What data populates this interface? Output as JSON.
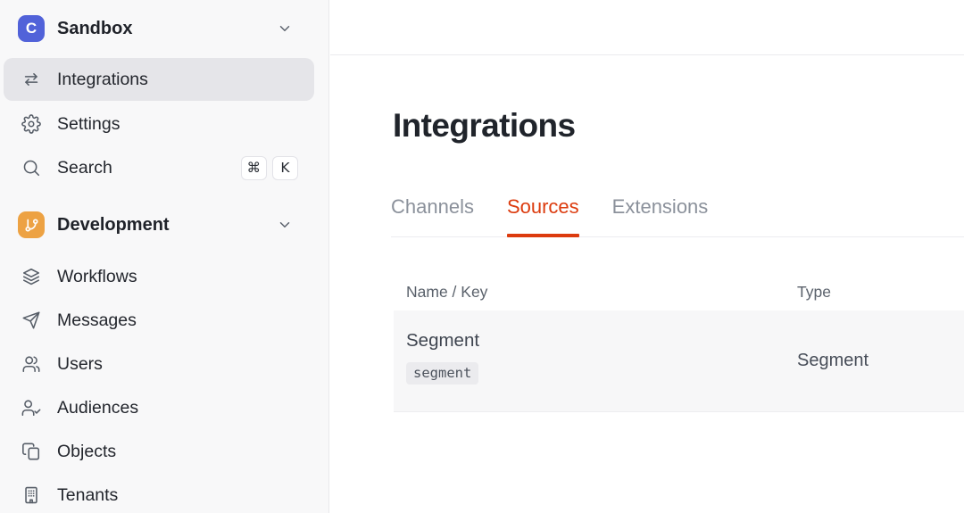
{
  "colors": {
    "accent_red": "#dc3b0e",
    "logo_indigo": "#5162d9",
    "section_orange": "#eda243",
    "sidebar_bg": "#f8f8f9",
    "active_item_bg": "#e5e5e9",
    "row_bg": "#f7f7f8"
  },
  "sidebar": {
    "workspace": {
      "initial": "C",
      "name": "Sandbox"
    },
    "items": [
      {
        "label": "Integrations",
        "icon": "swap-horizontal-icon",
        "active": true
      },
      {
        "label": "Settings",
        "icon": "gear-icon",
        "active": false
      },
      {
        "label": "Search",
        "icon": "search-icon",
        "active": false,
        "shortcut": [
          "⌘",
          "K"
        ]
      }
    ],
    "section": {
      "name": "Development",
      "icon": "git-branch-icon"
    },
    "section_items": [
      {
        "label": "Workflows",
        "icon": "layers-icon"
      },
      {
        "label": "Messages",
        "icon": "paper-plane-icon"
      },
      {
        "label": "Users",
        "icon": "users-icon"
      },
      {
        "label": "Audiences",
        "icon": "user-check-icon"
      },
      {
        "label": "Objects",
        "icon": "copy-icon"
      },
      {
        "label": "Tenants",
        "icon": "building-icon"
      }
    ]
  },
  "main": {
    "title": "Integrations",
    "tabs": [
      {
        "label": "Channels",
        "active": false
      },
      {
        "label": "Sources",
        "active": true
      },
      {
        "label": "Extensions",
        "active": false
      }
    ],
    "table": {
      "columns": [
        "Name / Key",
        "Type"
      ],
      "rows": [
        {
          "name": "Segment",
          "key": "segment",
          "type": "Segment"
        }
      ]
    }
  }
}
